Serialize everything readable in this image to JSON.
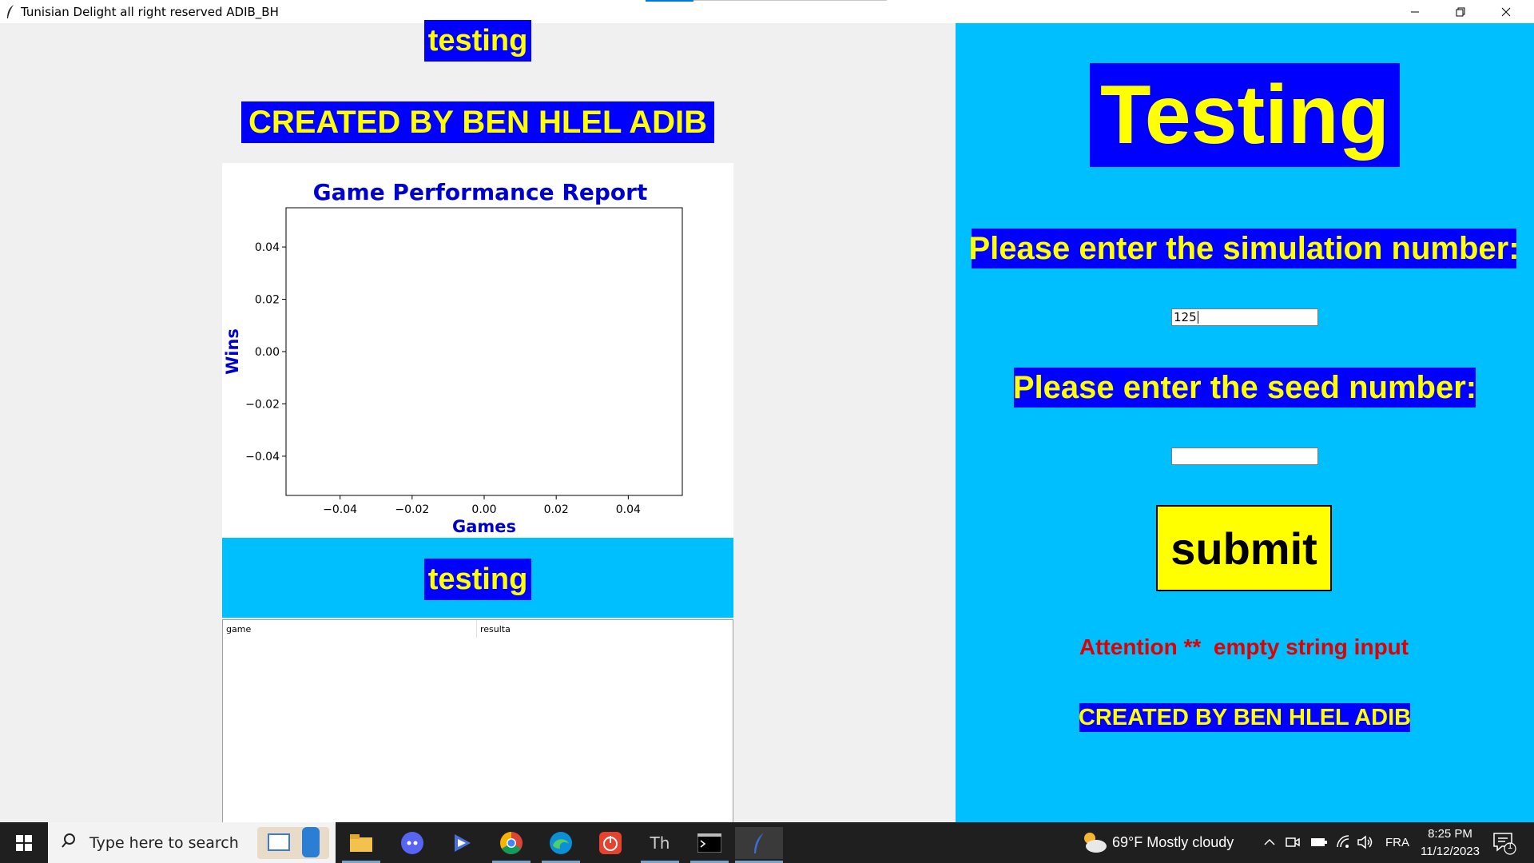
{
  "window": {
    "title": "Tunisian Delight all right reserved ADIB_BH"
  },
  "left": {
    "label_top": "testing",
    "created_by": "CREATED BY BEN HLEL ADIB",
    "label_mid": "testing"
  },
  "chart_data": {
    "type": "line",
    "title": "Game Performance Report",
    "xlabel": "Games",
    "ylabel": "Wins",
    "xlim": [
      -0.055,
      0.055
    ],
    "ylim": [
      -0.055,
      0.055
    ],
    "xticks": [
      -0.04,
      -0.02,
      0.0,
      0.02,
      0.04
    ],
    "yticks": [
      -0.04,
      -0.02,
      0.0,
      0.02,
      0.04
    ],
    "xtick_labels": [
      "−0.04",
      "−0.02",
      "0.00",
      "0.02",
      "0.04"
    ],
    "ytick_labels": [
      "−0.04",
      "−0.02",
      "0.00",
      "0.02",
      "0.04"
    ],
    "series": [],
    "grid": false,
    "colors": {
      "title": "#0000cd",
      "labels": "#0000cd"
    }
  },
  "table": {
    "columns": [
      "game",
      "resulta"
    ],
    "rows": []
  },
  "right": {
    "heading": "Testing",
    "sim_label": "Please enter the simulation number:",
    "sim_value": "125",
    "seed_label": "Please enter the seed number:",
    "seed_value": "",
    "submit_label": "submit",
    "attention": "Attention **  empty string input",
    "created_by": "CREATED BY BEN HLEL ADIB"
  },
  "taskbar": {
    "search_placeholder": "Type here to search",
    "weather": "69°F  Mostly cloudy",
    "language": "FRA",
    "time": "8:25 PM",
    "date": "11/12/2023",
    "notification_count": "1",
    "apps": [
      "file-explorer-icon",
      "discord-icon",
      "media-icon",
      "chrome-icon",
      "edge-icon",
      "power-app-icon",
      "thonny-icon",
      "terminal-icon",
      "python-feather-icon"
    ]
  },
  "colors": {
    "accent_blue": "#0000ff",
    "label_yellow": "#ffff00",
    "panel_cyan": "#00bfff",
    "alert_red": "#e00000"
  }
}
